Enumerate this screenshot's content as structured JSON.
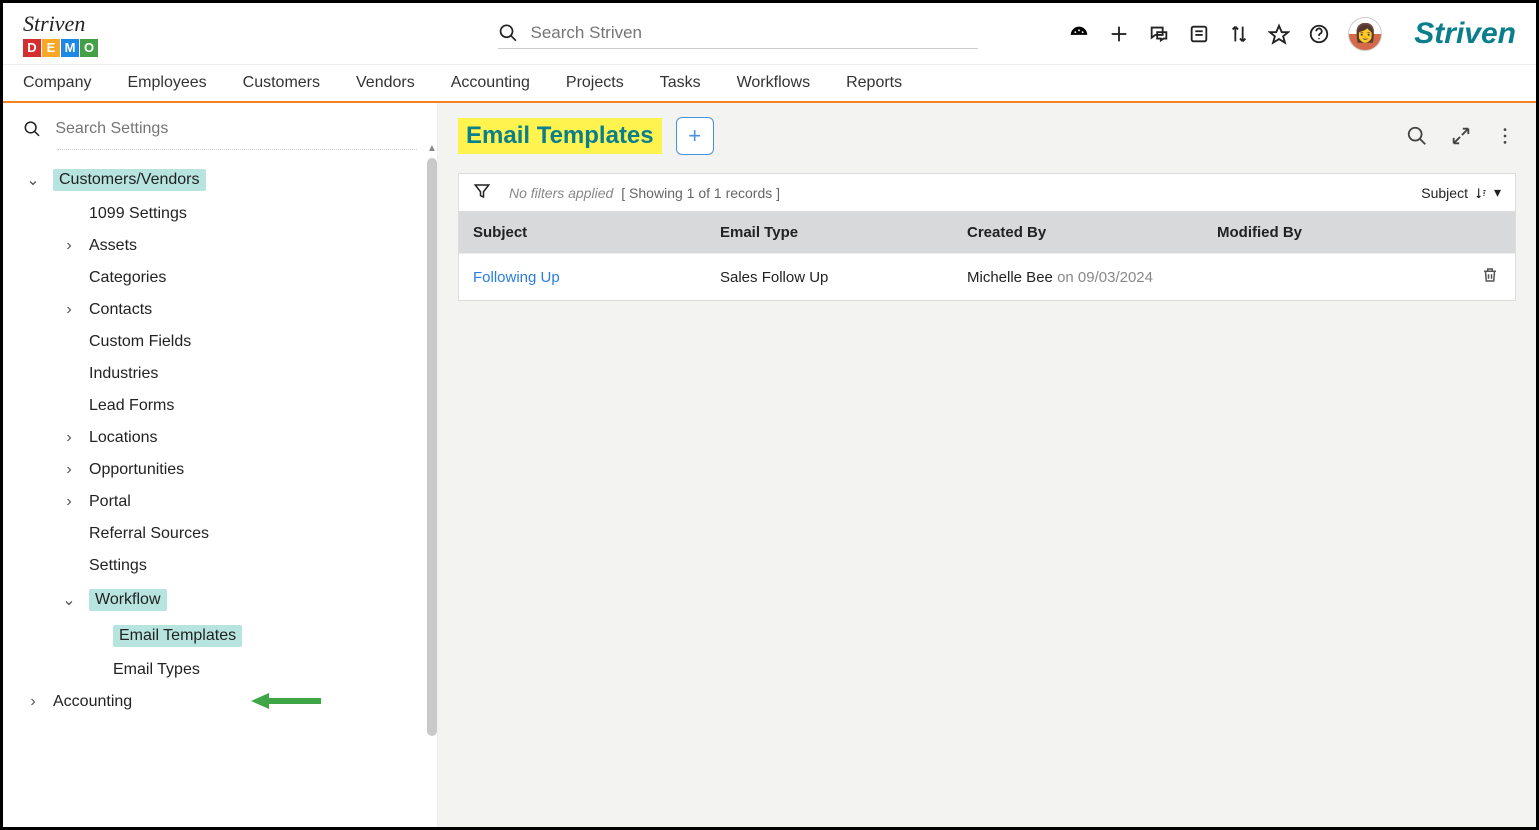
{
  "header": {
    "logo_script": "Striven",
    "logo_letters": [
      "D",
      "E",
      "M",
      "O"
    ],
    "search_placeholder": "Search Striven",
    "brand": "Striven"
  },
  "nav": {
    "items": [
      "Company",
      "Employees",
      "Customers",
      "Vendors",
      "Accounting",
      "Projects",
      "Tasks",
      "Workflows",
      "Reports"
    ]
  },
  "sidebar": {
    "search_placeholder": "Search Settings",
    "section_label": "Customers/Vendors",
    "items": [
      {
        "label": "1099 Settings",
        "chev": ""
      },
      {
        "label": "Assets",
        "chev": "›"
      },
      {
        "label": "Categories",
        "chev": ""
      },
      {
        "label": "Contacts",
        "chev": "›"
      },
      {
        "label": "Custom Fields",
        "chev": ""
      },
      {
        "label": "Industries",
        "chev": ""
      },
      {
        "label": "Lead Forms",
        "chev": ""
      },
      {
        "label": "Locations",
        "chev": "›"
      },
      {
        "label": "Opportunities",
        "chev": "›"
      },
      {
        "label": "Portal",
        "chev": "›"
      },
      {
        "label": "Referral Sources",
        "chev": ""
      },
      {
        "label": "Settings",
        "chev": ""
      }
    ],
    "workflow_label": "Workflow",
    "workflow_children": [
      {
        "label": "Email Templates",
        "highlighted": true
      },
      {
        "label": "Email Types",
        "highlighted": false
      }
    ],
    "accounting_label": "Accounting"
  },
  "main": {
    "title": "Email Templates",
    "filter": {
      "no_filters": "No filters applied",
      "showing": "[ Showing 1 of 1 records ]",
      "sort_label": "Subject"
    },
    "columns": [
      "Subject",
      "Email Type",
      "Created By",
      "Modified By"
    ],
    "rows": [
      {
        "subject": "Following Up",
        "type": "Sales Follow Up",
        "created_by": "Michelle Bee",
        "created_on": "on 09/03/2024",
        "modified_by": ""
      }
    ]
  }
}
